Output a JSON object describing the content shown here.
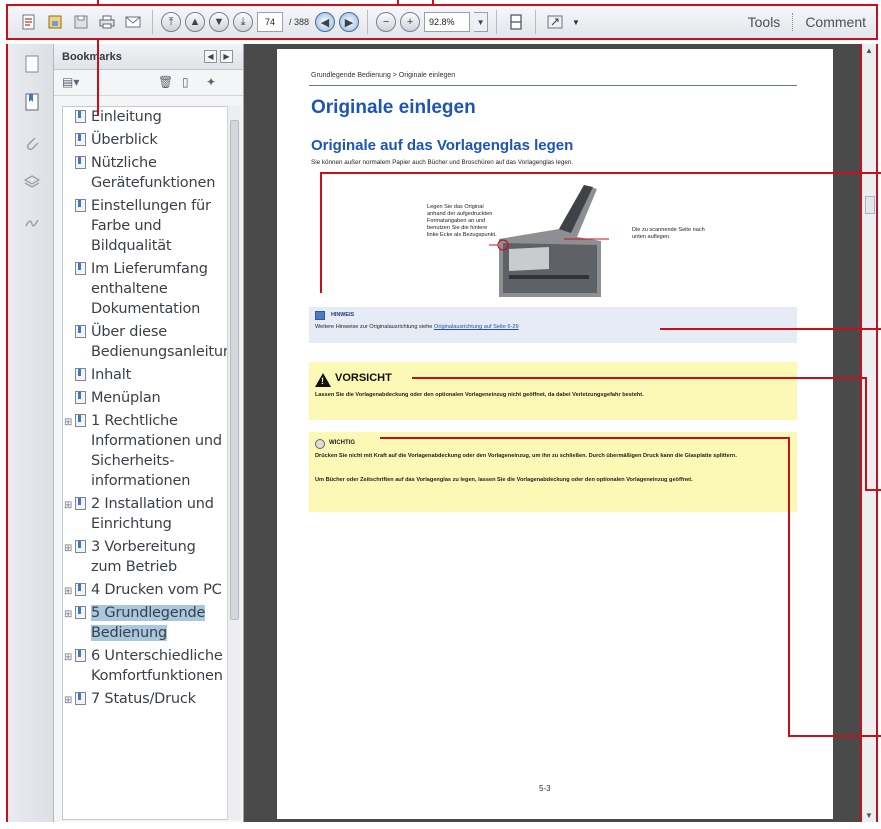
{
  "toolbar": {
    "page_current": "74",
    "page_total": "/ 388",
    "zoom": "92.8%",
    "zoom_drop": "▼",
    "fit_drop": "▼",
    "tools_label": "Tools",
    "comment_label": "Comment",
    "icons": [
      "create-icon",
      "save-icon",
      "disk-icon",
      "print-icon",
      "email-icon",
      "first-page-icon",
      "prev-page-icon",
      "next-page-icon",
      "last-page-icon",
      "back-icon",
      "forward-icon",
      "zoom-out-icon",
      "zoom-in-icon",
      "fit-page-icon",
      "fullscreen-icon"
    ]
  },
  "bookmarks": {
    "title": "Bookmarks",
    "items": [
      {
        "label": "Einleitung",
        "expandable": false,
        "selected": false
      },
      {
        "label": "Überblick",
        "expandable": false,
        "selected": false
      },
      {
        "label": "Nützliche Gerätefunktionen",
        "expandable": false,
        "selected": false
      },
      {
        "label": "Einstellungen für Farbe und Bildqualität",
        "expandable": false,
        "selected": false
      },
      {
        "label": "Im Lieferumfang enthaltene Dokumentation",
        "expandable": false,
        "selected": false
      },
      {
        "label": "Über diese Bedienungsanleitung",
        "expandable": false,
        "selected": false
      },
      {
        "label": "Inhalt",
        "expandable": false,
        "selected": false
      },
      {
        "label": "Menüplan",
        "expandable": false,
        "selected": false
      },
      {
        "label": "1 Rechtliche Informationen und Sicherheits-informationen",
        "expandable": true,
        "selected": false
      },
      {
        "label": "2 Installation und Einrichtung",
        "expandable": true,
        "selected": false
      },
      {
        "label": "3 Vorbereitung zum Betrieb",
        "expandable": true,
        "selected": false
      },
      {
        "label": "4 Drucken vom PC",
        "expandable": true,
        "selected": false
      },
      {
        "label": "5 Grundlegende Bedienung",
        "expandable": true,
        "selected": true
      },
      {
        "label": "6 Unterschiedliche Komfortfunktionen",
        "expandable": true,
        "selected": false
      },
      {
        "label": "7 Status/Druck",
        "expandable": true,
        "selected": false
      }
    ]
  },
  "document": {
    "breadcrumb": "Grundlegende Bedienung > Originale einlegen",
    "heading1": "Originale einlegen",
    "heading2": "Originale auf das Vorlagenglas legen",
    "intro": "Sie können außer normalem Papier auch Bücher und Broschüren auf das Vorlagenglas legen.",
    "figure_left": "Legen Sie das Original anhand der aufgedruckten Formatangaben an und benutzen Sie die hintere linke Ecke als Bezugspunkt.",
    "figure_right": "Die zu scannende Seite nach unten auflegen.",
    "note_title": "HINWEIS",
    "note_text": "Weitere Hinweise zur Originalausrichtung siehe ",
    "note_link": "Originalausrichtung auf Seite 6-29",
    "caution_title": "VORSICHT",
    "caution_text": "Lassen Sie die Vorlagenabdeckung oder den optionalen Vorlageneinzug nicht geöffnet, da dabei Verletzungsgefahr besteht.",
    "important_title": "WICHTIG",
    "important_text1": "Drücken Sie nicht mit Kraft auf die Vorlagenabdeckung oder den Vorlageneinzug, um ihn zu schließen. Durch übermäßigen Druck kann die Glasplatte splittern.",
    "important_text2": "Um Bücher oder Zeitschriften auf das Vorlagenglas zu legen, lassen Sie die Vorlagenabdeckung oder den optionalen Vorlageneinzug geöffnet.",
    "page_number": "5-3"
  },
  "colors": {
    "annotation": "#c8101a",
    "heading_blue": "#1d55b4",
    "caution_bg": "#fbf9b5",
    "note_bg": "#e6ebf6",
    "selected_bg": "#a9c8de"
  }
}
